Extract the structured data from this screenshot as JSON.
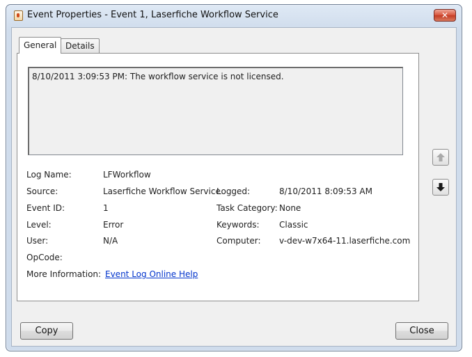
{
  "window": {
    "title": "Event Properties - Event 1, Laserfiche Workflow Service",
    "close_glyph": "✕"
  },
  "tabs": [
    {
      "label": "General",
      "selected": true
    },
    {
      "label": "Details",
      "selected": false
    }
  ],
  "description": "8/10/2011 3:09:53 PM: The workflow service is not licensed.",
  "fields": {
    "log_name": {
      "label": "Log Name:",
      "value": "LFWorkflow"
    },
    "source": {
      "label": "Source:",
      "value": "Laserfiche Workflow Service"
    },
    "logged": {
      "label": "Logged:",
      "value": "8/10/2011 8:09:53 AM"
    },
    "event_id": {
      "label": "Event ID:",
      "value": "1"
    },
    "task_category": {
      "label": "Task Category:",
      "value": "None"
    },
    "level": {
      "label": "Level:",
      "value": "Error"
    },
    "keywords": {
      "label": "Keywords:",
      "value": "Classic"
    },
    "user": {
      "label": "User:",
      "value": "N/A"
    },
    "computer": {
      "label": "Computer:",
      "value": "v-dev-w7x64-11.laserfiche.com"
    },
    "opcode": {
      "label": "OpCode:",
      "value": ""
    },
    "more_information": {
      "label": "More Information:",
      "link_text": "Event Log Online Help"
    }
  },
  "nav": {
    "up_icon": "arrow-up",
    "down_icon": "arrow-down",
    "up_enabled": false,
    "down_enabled": true
  },
  "buttons": {
    "copy": "Copy",
    "close": "Close"
  }
}
